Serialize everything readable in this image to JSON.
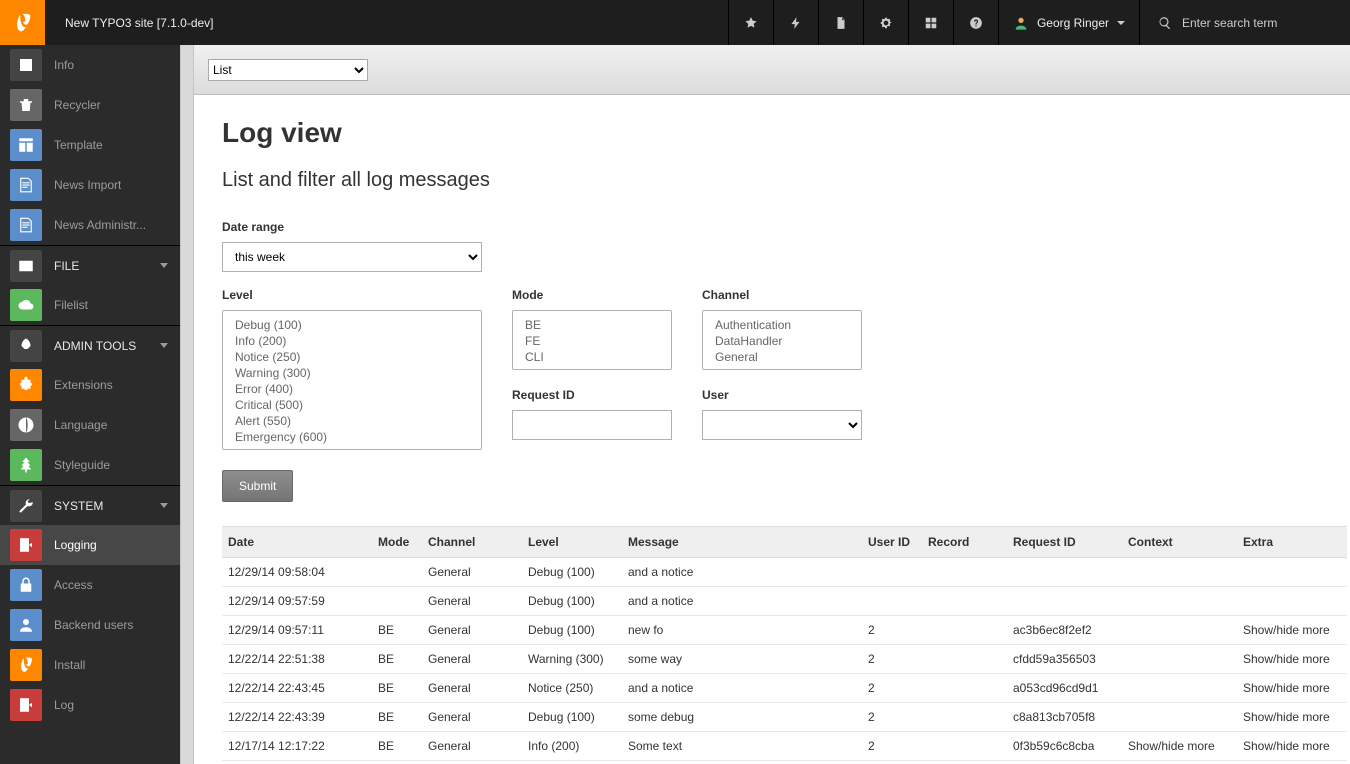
{
  "topbar": {
    "site_title": "New TYPO3 site [7.1.0-dev]",
    "user_name": "Georg Ringer",
    "search_placeholder": "Enter search term"
  },
  "sidebar": {
    "pre_items": [
      {
        "label": "Info",
        "icon": "info-icon",
        "tile": "bg-dark"
      },
      {
        "label": "Recycler",
        "icon": "trash-icon",
        "tile": "bg-grey"
      },
      {
        "label": "Template",
        "icon": "template-icon",
        "tile": "bg-blue"
      },
      {
        "label": "News Import",
        "icon": "doc-icon",
        "tile": "bg-blue"
      },
      {
        "label": "News Administr...",
        "icon": "doc-icon",
        "tile": "bg-blue"
      }
    ],
    "groups": [
      {
        "label": "FILE",
        "icon": "image-icon",
        "items": [
          {
            "label": "Filelist",
            "icon": "cloud-icon",
            "tile": "bg-green"
          }
        ]
      },
      {
        "label": "ADMIN TOOLS",
        "icon": "rocket-icon",
        "items": [
          {
            "label": "Extensions",
            "icon": "puzzle-icon",
            "tile": "bg-orange"
          },
          {
            "label": "Language",
            "icon": "globe-icon",
            "tile": "bg-grey"
          },
          {
            "label": "Styleguide",
            "icon": "tree-icon",
            "tile": "bg-green"
          }
        ]
      },
      {
        "label": "SYSTEM",
        "icon": "wrench-icon",
        "items": [
          {
            "label": "Logging",
            "icon": "door-icon",
            "tile": "bg-red",
            "active": true
          },
          {
            "label": "Access",
            "icon": "lock-icon",
            "tile": "bg-blue"
          },
          {
            "label": "Backend users",
            "icon": "user-icon",
            "tile": "bg-blue"
          },
          {
            "label": "Install",
            "icon": "typo3-icon",
            "tile": "bg-orange"
          },
          {
            "label": "Log",
            "icon": "door-icon",
            "tile": "bg-red"
          }
        ]
      }
    ]
  },
  "docheader": {
    "mode_select": "List"
  },
  "page": {
    "title": "Log view",
    "subtitle": "List and filter all log messages",
    "labels": {
      "date_range": "Date range",
      "level": "Level",
      "mode": "Mode",
      "channel": "Channel",
      "request_id": "Request ID",
      "user": "User",
      "submit": "Submit"
    },
    "date_range_value": "this week",
    "levels": [
      "Debug (100)",
      "Info (200)",
      "Notice (250)",
      "Warning (300)",
      "Error (400)",
      "Critical (500)",
      "Alert (550)",
      "Emergency (600)"
    ],
    "modes": [
      "BE",
      "FE",
      "CLI"
    ],
    "channels": [
      "Authentication",
      "DataHandler",
      "General"
    ]
  },
  "table": {
    "columns": [
      "Date",
      "Mode",
      "Channel",
      "Level",
      "Message",
      "User ID",
      "Record",
      "Request ID",
      "Context",
      "Extra"
    ],
    "rows": [
      {
        "date": "12/29/14 09:58:04",
        "mode": "",
        "channel": "General",
        "level": "Debug (100)",
        "message": "and a notice",
        "user_id": "",
        "record": "",
        "request_id": "",
        "context": "",
        "extra": ""
      },
      {
        "date": "12/29/14 09:57:59",
        "mode": "",
        "channel": "General",
        "level": "Debug (100)",
        "message": "and a notice",
        "user_id": "",
        "record": "",
        "request_id": "",
        "context": "",
        "extra": ""
      },
      {
        "date": "12/29/14 09:57:11",
        "mode": "BE",
        "channel": "General",
        "level": "Debug (100)",
        "message": "new fo",
        "user_id": "2",
        "record": "",
        "request_id": "ac3b6ec8f2ef2",
        "context": "",
        "extra": "Show/hide more"
      },
      {
        "date": "12/22/14 22:51:38",
        "mode": "BE",
        "channel": "General",
        "level": "Warning (300)",
        "message": "some way",
        "user_id": "2",
        "record": "",
        "request_id": "cfdd59a356503",
        "context": "",
        "extra": "Show/hide more"
      },
      {
        "date": "12/22/14 22:43:45",
        "mode": "BE",
        "channel": "General",
        "level": "Notice (250)",
        "message": "and a notice",
        "user_id": "2",
        "record": "",
        "request_id": "a053cd96cd9d1",
        "context": "",
        "extra": "Show/hide more"
      },
      {
        "date": "12/22/14 22:43:39",
        "mode": "BE",
        "channel": "General",
        "level": "Debug (100)",
        "message": "some debug",
        "user_id": "2",
        "record": "",
        "request_id": "c8a813cb705f8",
        "context": "",
        "extra": "Show/hide more"
      },
      {
        "date": "12/17/14 12:17:22",
        "mode": "BE",
        "channel": "General",
        "level": "Info (200)",
        "message": "Some text",
        "user_id": "2",
        "record": "",
        "request_id": "0f3b59c6c8cba",
        "context": "Show/hide more",
        "extra": "Show/hide more"
      }
    ]
  }
}
